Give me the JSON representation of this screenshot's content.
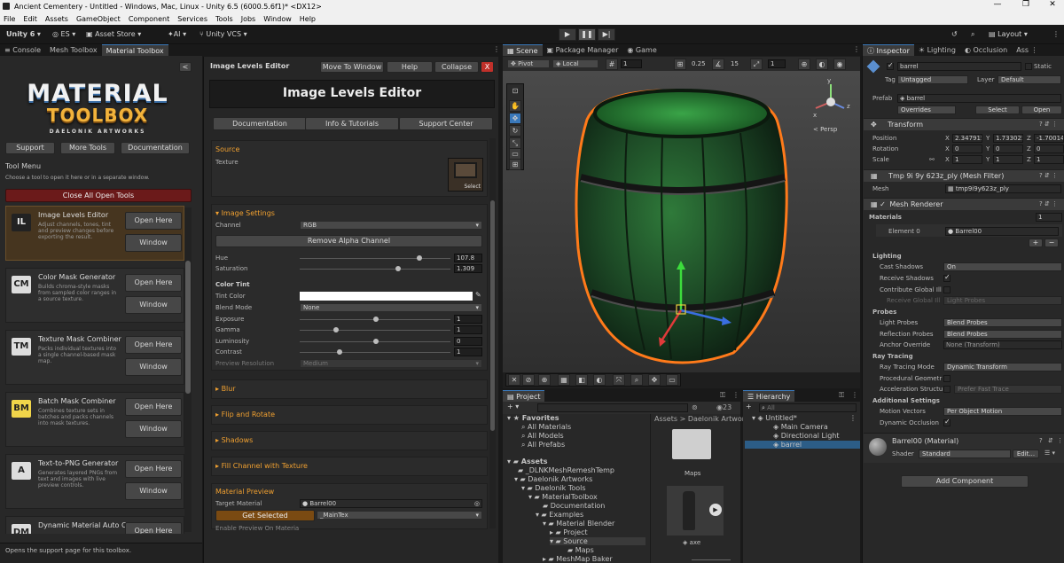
{
  "window": {
    "title": "Ancient Cementery - Untitled - Windows, Mac, Linux - Unity 6.5 (6000.5.6f1)* <DX12>",
    "controls": [
      "—",
      "❐",
      "✕"
    ]
  },
  "menu": [
    "File",
    "Edit",
    "Assets",
    "GameObject",
    "Component",
    "Services",
    "Tools",
    "Jobs",
    "Window",
    "Help"
  ],
  "toolbar": {
    "unity": "Unity 6",
    "account": "ES",
    "store": "Asset Store",
    "ai": "AI",
    "vcs": "Unity VCS",
    "layout": "Layout"
  },
  "left_tabs": [
    "Console",
    "Mesh Toolbox",
    "Material Toolbox"
  ],
  "toolbox": {
    "collapse_symbol": "<",
    "logo_line1": "MATERIAL",
    "logo_line2": "TOOLBOX",
    "logo_sub": "DAELONIK ARTWORKS",
    "buttons": [
      "Support",
      "More Tools",
      "Documentation"
    ],
    "menu_title": "Tool Menu",
    "menu_hint": "Choose a tool to open it here or in a separate window.",
    "close_all": "Close All Open Tools",
    "tools": [
      {
        "name": "Image Levels Editor",
        "desc": "Adjust channels, tones, tint and preview changes before exporting the result.",
        "icon": "IL",
        "open": "Open Here",
        "window": "Window"
      },
      {
        "name": "Color Mask Generator",
        "desc": "Builds chroma-style masks from sampled color ranges in a source texture.",
        "icon": "CM",
        "open": "Open Here",
        "window": "Window"
      },
      {
        "name": "Texture Mask Combiner",
        "desc": "Packs individual textures into a single channel-based mask map.",
        "icon": "TM",
        "open": "Open Here",
        "window": "Window"
      },
      {
        "name": "Batch Mask Combiner",
        "desc": "Combines texture sets in batches and packs channels into mask textures.",
        "icon": "BM",
        "open": "Open Here",
        "window": "Window"
      },
      {
        "name": "Text-to-PNG Generator",
        "desc": "Generates layered PNGs from text and images with live preview controls.",
        "icon": "A",
        "open": "Open Here",
        "window": "Window"
      },
      {
        "name": "Dynamic Material Auto Creator",
        "desc": "",
        "icon": "DM",
        "open": "Open Here",
        "window": ""
      }
    ],
    "status": "Opens the support page for this toolbox."
  },
  "editor": {
    "title": "Image Levels Editor",
    "move": "Move To Window",
    "help": "Help",
    "collapse": "Collapse",
    "close": "X",
    "banner": "Image Levels Editor",
    "links": [
      "Documentation",
      "Info & Tutorials",
      "Support Center"
    ],
    "source": "Source",
    "texture": "Texture",
    "select": "Select",
    "image_settings": "Image Settings",
    "channel_label": "Channel",
    "channel_value": "RGB",
    "remove_alpha": "Remove Alpha Channel",
    "hue_label": "Hue",
    "hue_value": "107.8",
    "sat_label": "Saturation",
    "sat_value": "1.309",
    "color_tint": "Color Tint",
    "tint_label": "Tint Color",
    "blend_label": "Blend Mode",
    "blend_value": "None",
    "exposure_label": "Exposure",
    "exposure_value": "1",
    "gamma_label": "Gamma",
    "gamma_value": "1",
    "lum_label": "Luminosity",
    "lum_value": "0",
    "contrast_label": "Contrast",
    "contrast_value": "1",
    "preview_res_label": "Preview Resolution",
    "preview_res_value": "Medium",
    "blur": "Blur",
    "flip": "Flip and Rotate",
    "shadows": "Shadows",
    "fill": "Fill Channel with Texture",
    "material_preview": "Material Preview",
    "target_label": "Target Material",
    "target_value": "Barrel00",
    "get_selected": "Get Selected",
    "maintex": "_MainTex",
    "enable_preview": "Enable Preview On Materia"
  },
  "scene": {
    "tabs": [
      "Scene",
      "Package Manager",
      "Game"
    ],
    "pivot": "Pivot",
    "local": "Local",
    "grid": "1",
    "snap": "0.25",
    "angle": "15",
    "scale": "1",
    "persp": "< Persp",
    "axis_x": "x",
    "axis_y": "y",
    "axis_z": "z"
  },
  "project": {
    "tab": "Project",
    "count": "23",
    "favorites": "Favorites",
    "fav_items": [
      "All Materials",
      "All Models",
      "All Prefabs"
    ],
    "assets": "Assets",
    "tree": [
      "_DLNKMeshRemeshTemp",
      "Daelonik Artworks",
      "Daelonik Tools",
      "MaterialToolbox",
      "Documentation",
      "Examples",
      "Material Blender",
      "Project",
      "Source",
      "Maps",
      "MeshMap Baker"
    ],
    "breadcrumb": "Assets > Daelonik Artwork",
    "grid_items": [
      "Maps",
      "axe"
    ]
  },
  "hierarchy": {
    "tab": "Hierarchy",
    "search_placeholder": "All",
    "scene_name": "Untitled*",
    "items": [
      "Main Camera",
      "Directional Light",
      "barrel"
    ]
  },
  "inspector": {
    "tabs": [
      "Inspector",
      "Lighting",
      "Occlusion",
      "Ass"
    ],
    "object_name": "barrel",
    "static_label": "Static",
    "tag_label": "Tag",
    "tag_value": "Untagged",
    "layer_label": "Layer",
    "layer_value": "Default",
    "prefab_label": "Prefab",
    "prefab_value": "barrel",
    "overrides": "Overrides",
    "select": "Select",
    "open": "Open",
    "transform": "Transform",
    "position_label": "Position",
    "rotation_label": "Rotation",
    "scale_label": "Scale",
    "pos": [
      "2.347915",
      "1.733025",
      "-1.70014"
    ],
    "rot": [
      "0",
      "0",
      "0"
    ],
    "scl": [
      "1",
      "1",
      "1"
    ],
    "axis": [
      "X",
      "Y",
      "Z"
    ],
    "mesh_filter": "Tmp 9i 9y 623z_ply (Mesh Filter)",
    "mesh_label": "Mesh",
    "mesh_value": "tmp9i9y623z_ply",
    "mesh_renderer": "Mesh Renderer",
    "materials": "Materials",
    "materials_count": "1",
    "element_label": "Element 0",
    "element_value": "Barrel00",
    "plus": "+",
    "minus": "−",
    "lighting": "Lighting",
    "cast_label": "Cast Shadows",
    "cast_value": "On",
    "receive_label": "Receive Shadows",
    "contribute_label": "Contribute Global Ill",
    "receive_gi_label": "Receive Global Ill",
    "receive_gi_value": "Light Probes",
    "probes": "Probes",
    "light_probes_label": "Light Probes",
    "light_probes_value": "Blend Probes",
    "refl_label": "Reflection Probes",
    "refl_value": "Blend Probes",
    "anchor_label": "Anchor Override",
    "anchor_value": "None (Transform)",
    "ray": "Ray Tracing",
    "ray_mode_label": "Ray Tracing Mode",
    "ray_mode_value": "Dynamic Transform",
    "proc_label": "Procedural Geometr",
    "accel_label": "Acceleration Structu",
    "accel_value": "Prefer Fast Trace",
    "additional": "Additional Settings",
    "motion_label": "Motion Vectors",
    "motion_value": "Per Object Motion",
    "dyn_occ_label": "Dynamic Occlusion",
    "material_name": "Barrel00 (Material)",
    "shader_label": "Shader",
    "shader_value": "Standard",
    "edit": "Edit...",
    "add_component": "Add Component"
  },
  "colors": {
    "accent": "#3a79bb",
    "orange": "#f0a030",
    "close": "#c0302a",
    "gold": "#e8b040"
  }
}
